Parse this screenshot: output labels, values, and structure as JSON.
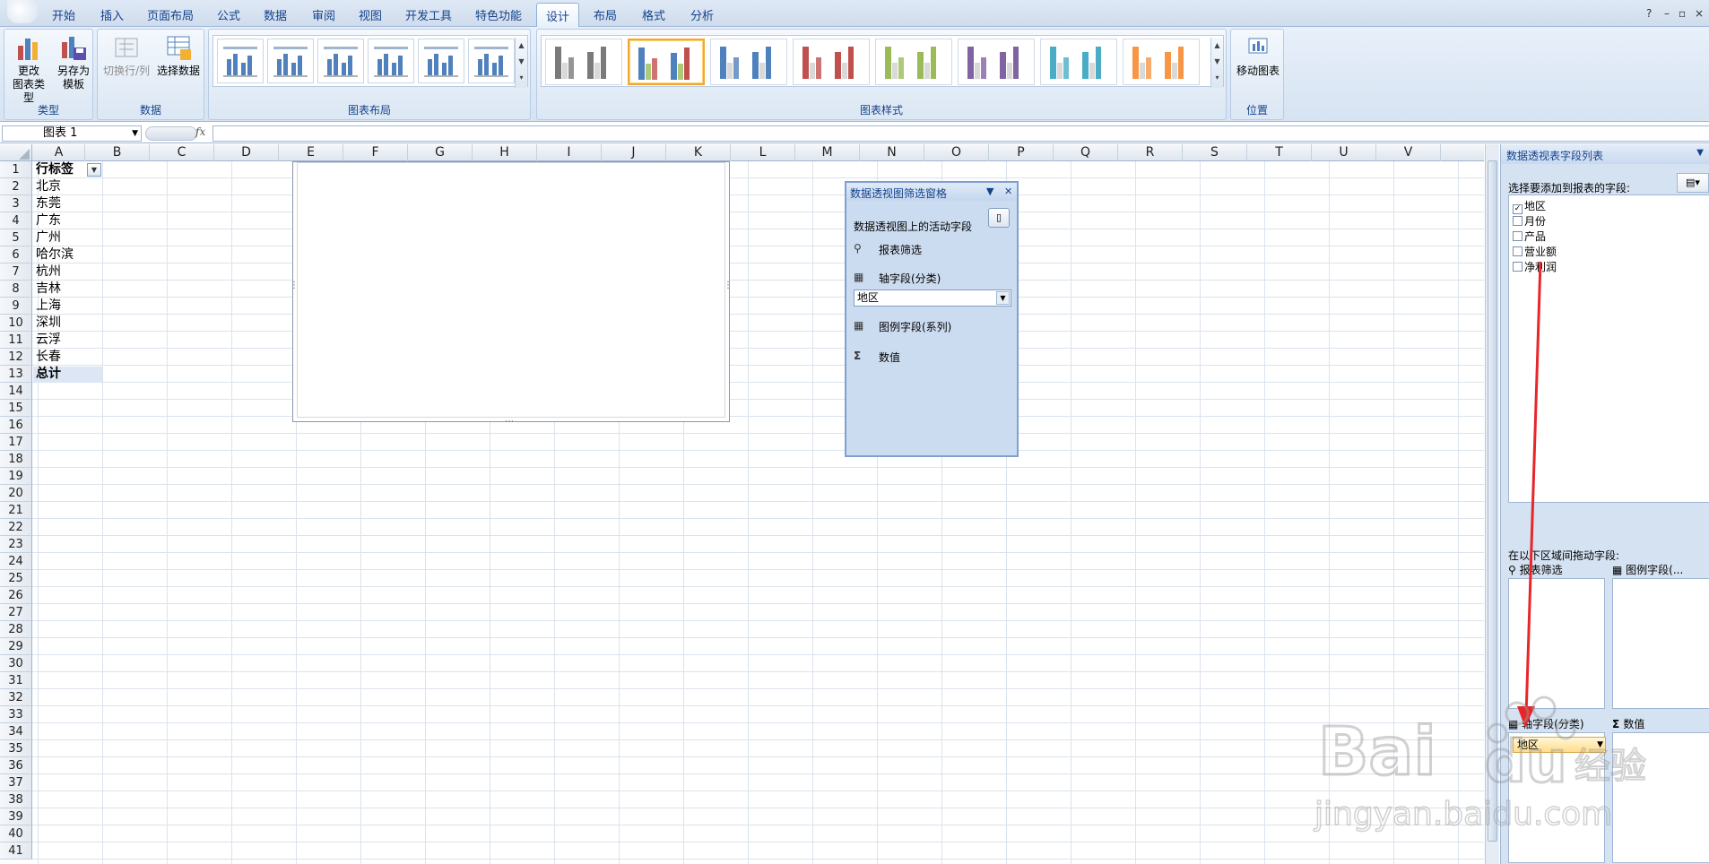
{
  "ribbon_tabs": [
    "开始",
    "插入",
    "页面布局",
    "公式",
    "数据",
    "审阅",
    "视图",
    "开发工具",
    "特色功能",
    "设计",
    "布局",
    "格式",
    "分析"
  ],
  "active_tab": "设计",
  "groups": {
    "type": {
      "label": "类型",
      "change_type": "更改\n图表类型",
      "save_template": "另存为\n模板"
    },
    "data": {
      "label": "数据",
      "switch_row_col": "切换行/列",
      "select_data": "选择数据"
    },
    "layout": {
      "label": "图表布局"
    },
    "styles": {
      "label": "图表样式",
      "palettes": [
        "#7a7a7a",
        "#c0504d",
        "#4f81bd",
        "#c0504d",
        "#9bbb59",
        "#8064a2",
        "#4bacc6",
        "#f79646"
      ]
    },
    "location": {
      "label": "位置",
      "move_chart": "移动图表"
    }
  },
  "formula_bar": {
    "name_box": "图表 1",
    "fx": "fx",
    "value": ""
  },
  "columns": [
    "A",
    "B",
    "C",
    "D",
    "E",
    "F",
    "G",
    "H",
    "I",
    "J",
    "K",
    "L",
    "M",
    "N",
    "O",
    "P",
    "Q",
    "R",
    "S",
    "T",
    "U",
    "V"
  ],
  "rows": [
    "1",
    "2",
    "3",
    "4",
    "5",
    "6",
    "7",
    "8",
    "9",
    "10",
    "11",
    "12",
    "13",
    "14",
    "15",
    "16",
    "17",
    "18",
    "19",
    "20",
    "21",
    "22",
    "23",
    "24",
    "25",
    "26",
    "27",
    "28",
    "29",
    "30",
    "31",
    "32",
    "33",
    "34",
    "35",
    "36",
    "37",
    "38",
    "39",
    "40",
    "41"
  ],
  "pivot": {
    "header": "行标签",
    "items": [
      "北京",
      "东莞",
      "广东",
      "广州",
      "哈尔滨",
      "杭州",
      "吉林",
      "上海",
      "深圳",
      "云浮",
      "长春"
    ],
    "total": "总计"
  },
  "filter_pane": {
    "title": "数据透视图筛选窗格",
    "active_fields": "数据透视图上的活动字段",
    "report_filter": "报表筛选",
    "axis_fields": "轴字段(分类)",
    "axis_value": "地区",
    "legend_fields": "图例字段(系列)",
    "values": "数值"
  },
  "field_list": {
    "title": "数据透视表字段列表",
    "choose_label": "选择要添加到报表的字段:",
    "fields": [
      {
        "name": "地区",
        "checked": true
      },
      {
        "name": "月份",
        "checked": false
      },
      {
        "name": "产品",
        "checked": false
      },
      {
        "name": "营业额",
        "checked": false
      },
      {
        "name": "净利润",
        "checked": false
      }
    ],
    "drag_label": "在以下区域间拖动字段:",
    "zone_report_filter": "报表筛选",
    "zone_legend": "图例字段(...",
    "zone_axis": "轴字段(分类)",
    "zone_values": "数值",
    "axis_item": "地区"
  },
  "watermark": {
    "brand": "Bai du 经验",
    "url": "jingyan.baidu.com"
  },
  "colors": {
    "accent": "#15428b",
    "arrow": "#e8262a"
  }
}
